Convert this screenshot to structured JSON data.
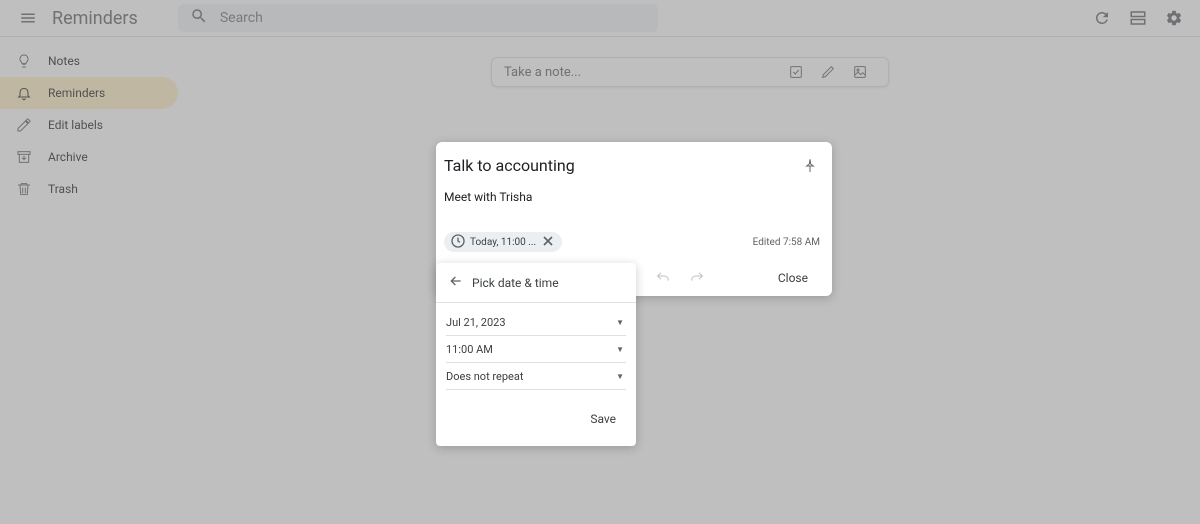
{
  "header": {
    "title": "Reminders",
    "search_placeholder": "Search"
  },
  "sidebar": {
    "items": [
      {
        "label": "Notes"
      },
      {
        "label": "Reminders"
      },
      {
        "label": "Edit labels"
      },
      {
        "label": "Archive"
      },
      {
        "label": "Trash"
      }
    ]
  },
  "note_input": {
    "placeholder": "Take a note..."
  },
  "note": {
    "title": "Talk to accounting",
    "body": "Meet with Trisha",
    "chip_label": "Today, 11:00 ...",
    "edited": "Edited 7:58 AM",
    "close": "Close"
  },
  "popover": {
    "title": "Pick date & time",
    "date": "Jul 21, 2023",
    "time": "11:00 AM",
    "repeat": "Does not repeat",
    "save": "Save"
  }
}
